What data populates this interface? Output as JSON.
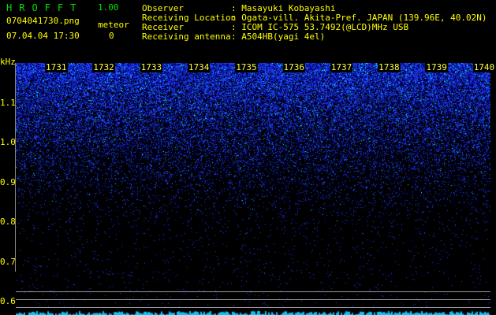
{
  "app": {
    "title": "HROFFT",
    "version": "1.00"
  },
  "file": {
    "name": "0704041730.png",
    "datetime": "07.04.04 17:30"
  },
  "meteor": {
    "label": "meteor",
    "count": "0"
  },
  "info": [
    {
      "label": "Observer",
      "value": ": Masayuki Kobayashi"
    },
    {
      "label": "Receiving Location",
      "value": ": Ogata-vill. Akita-Pref. JAPAN (139.96E, 40.02N)"
    },
    {
      "label": "Receiver",
      "value": ": ICOM IC-575 53.7492(@LCD)MHz USB"
    },
    {
      "label": "Receiving antenna",
      "value": ": A504HB(yagi 4el)"
    }
  ],
  "chart_data": {
    "type": "heatmap",
    "ylabel": "kHz",
    "y_ticks": [
      "1.1",
      "1.0",
      "0.9",
      "0.8",
      "0.7",
      "0.6"
    ],
    "x_ticks": [
      "1731",
      "1732",
      "1733",
      "1734",
      "1735",
      "1736",
      "1737",
      "1738",
      "1739",
      "1740"
    ],
    "ylim": [
      0.57,
      1.2
    ],
    "colors": {
      "strong": "#00ffff",
      "mid": "#2040ff",
      "weak": "#000080"
    }
  }
}
